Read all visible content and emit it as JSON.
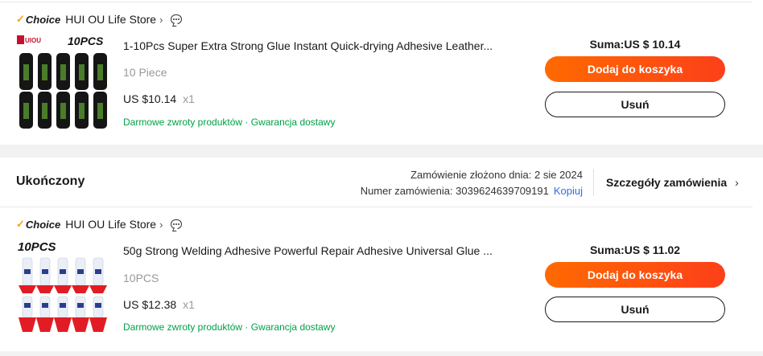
{
  "orders": [
    {
      "store": {
        "choice_label": "Choice",
        "name": "HUI OU Life Store"
      },
      "product": {
        "title": "1-10Pcs Super Extra Strong Glue Instant Quick-drying Adhesive Leather...",
        "variant": "10 Piece",
        "price": "US $10.14",
        "qty": "x1",
        "perk_returns": "Darmowe zwroty produktów",
        "perk_sep": "·",
        "perk_delivery": "Gwarancja dostawy",
        "thumb_text": "10PCS",
        "thumb_logo": "UIOU"
      },
      "sum": "Suma:US $ 10.14",
      "add_to_cart": "Dodaj do koszyka",
      "remove": "Usuń"
    },
    {
      "status": "Ukończony",
      "order_date_label": "Zamówienie złożono dnia: 2 sie 2024",
      "order_number_label": "Numer zamówienia: 3039624639709191",
      "copy_label": "Kopiuj",
      "details_label": "Szczegóły zamówienia",
      "store": {
        "choice_label": "Choice",
        "name": "HUI OU Life Store"
      },
      "product": {
        "title": "50g Strong Welding Adhesive Powerful Repair Adhesive Universal Glue ...",
        "variant": "10PCS",
        "price": "US $12.38",
        "qty": "x1",
        "perk_returns": "Darmowe zwroty produktów",
        "perk_sep": "·",
        "perk_delivery": "Gwarancja dostawy",
        "thumb_text": "10PCS"
      },
      "sum": "Suma:US $ 11.02",
      "add_to_cart": "Dodaj do koszyka",
      "remove": "Usuń"
    }
  ],
  "icons": {
    "store_chevron": "chevron-right-icon",
    "chat": "chat-icon",
    "details_arrow": "chevron-right-icon",
    "choice_tick": "check-icon"
  },
  "colors": {
    "accent": "#fd4c0c",
    "perk_green": "#00a046",
    "link_blue": "#2e6ce6",
    "choice_tick": "#f7a21b"
  }
}
